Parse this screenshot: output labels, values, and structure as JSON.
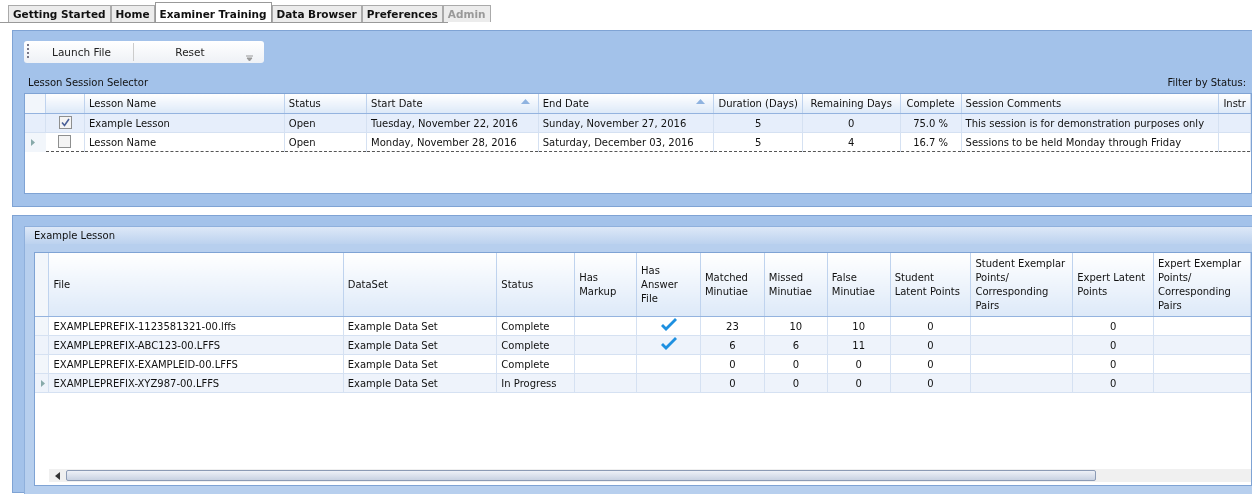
{
  "tabs": [
    {
      "label": "Getting Started",
      "selected": false,
      "disabled": false
    },
    {
      "label": "Home",
      "selected": false,
      "disabled": false
    },
    {
      "label": "Examiner Training",
      "selected": true,
      "disabled": false
    },
    {
      "label": "Data Browser",
      "selected": false,
      "disabled": false
    },
    {
      "label": "Preferences",
      "selected": false,
      "disabled": false
    },
    {
      "label": "Admin",
      "selected": false,
      "disabled": true
    }
  ],
  "toolbar": {
    "buttons": [
      "Launch File",
      "Reset"
    ]
  },
  "session_selector": {
    "title": "Lesson Session Selector",
    "filter_label": "Filter by Status:",
    "columns": [
      {
        "label": "Lesson Name",
        "sorted": false
      },
      {
        "label": "Status",
        "sorted": false
      },
      {
        "label": "Start Date",
        "sorted": true
      },
      {
        "label": "End Date",
        "sorted": true
      },
      {
        "label": "Duration (Days)",
        "sorted": false
      },
      {
        "label": "Remaining Days",
        "sorted": false
      },
      {
        "label": "Complete",
        "sorted": false
      },
      {
        "label": "Session Comments",
        "sorted": false
      },
      {
        "label": "Instr",
        "sorted": false
      }
    ],
    "rows": [
      {
        "checked": true,
        "selected": true,
        "current": false,
        "cells": [
          "Example Lesson",
          "Open",
          "Tuesday, November 22, 2016",
          "Sunday, November 27, 2016",
          "5",
          "0",
          "75.0 %",
          "This session is for demonstration purposes only"
        ]
      },
      {
        "checked": false,
        "selected": false,
        "current": true,
        "cells": [
          "Lesson Name",
          "Open",
          "Monday, November 28, 2016",
          "Saturday, December 03, 2016",
          "5",
          "4",
          "16.7 %",
          "Sessions to be held Monday through Friday"
        ]
      }
    ]
  },
  "lesson": {
    "title": "Example Lesson",
    "columns": [
      "File",
      "DataSet",
      "Status",
      "Has Markup",
      "Has Answer File",
      "Matched Minutiae",
      "Missed Minutiae",
      "False Minutiae",
      "Student Latent Points",
      "Student Exemplar Points/ Corresponding Pairs",
      "Expert Latent Points",
      "Expert Exemplar Points/ Corresponding Pairs"
    ],
    "rows": [
      {
        "current": false,
        "file": "EXAMPLEPREFIX-1123581321-00.lffs",
        "dataset": "Example Data Set",
        "status": "Complete",
        "has_markup": false,
        "has_answer_file": true,
        "matched": "23",
        "missed": "10",
        "false_minutiae": "10",
        "student_latent": "0",
        "expert_latent": "0"
      },
      {
        "current": false,
        "file": "EXAMPLEPREFIX-ABC123-00.LFFS",
        "dataset": "Example Data Set",
        "status": "Complete",
        "has_markup": false,
        "has_answer_file": true,
        "matched": "6",
        "missed": "6",
        "false_minutiae": "11",
        "student_latent": "0",
        "expert_latent": "0"
      },
      {
        "current": false,
        "file": "EXAMPLEPREFIX-EXAMPLEID-00.LFFS",
        "dataset": "Example Data Set",
        "status": "Complete",
        "has_markup": false,
        "has_answer_file": false,
        "matched": "0",
        "missed": "0",
        "false_minutiae": "0",
        "student_latent": "0",
        "expert_latent": "0"
      },
      {
        "current": true,
        "file": "EXAMPLEPREFIX-XYZ987-00.LFFS",
        "dataset": "Example Data Set",
        "status": "In Progress",
        "has_markup": false,
        "has_answer_file": false,
        "matched": "0",
        "missed": "0",
        "false_minutiae": "0",
        "student_latent": "0",
        "expert_latent": "0"
      }
    ]
  }
}
